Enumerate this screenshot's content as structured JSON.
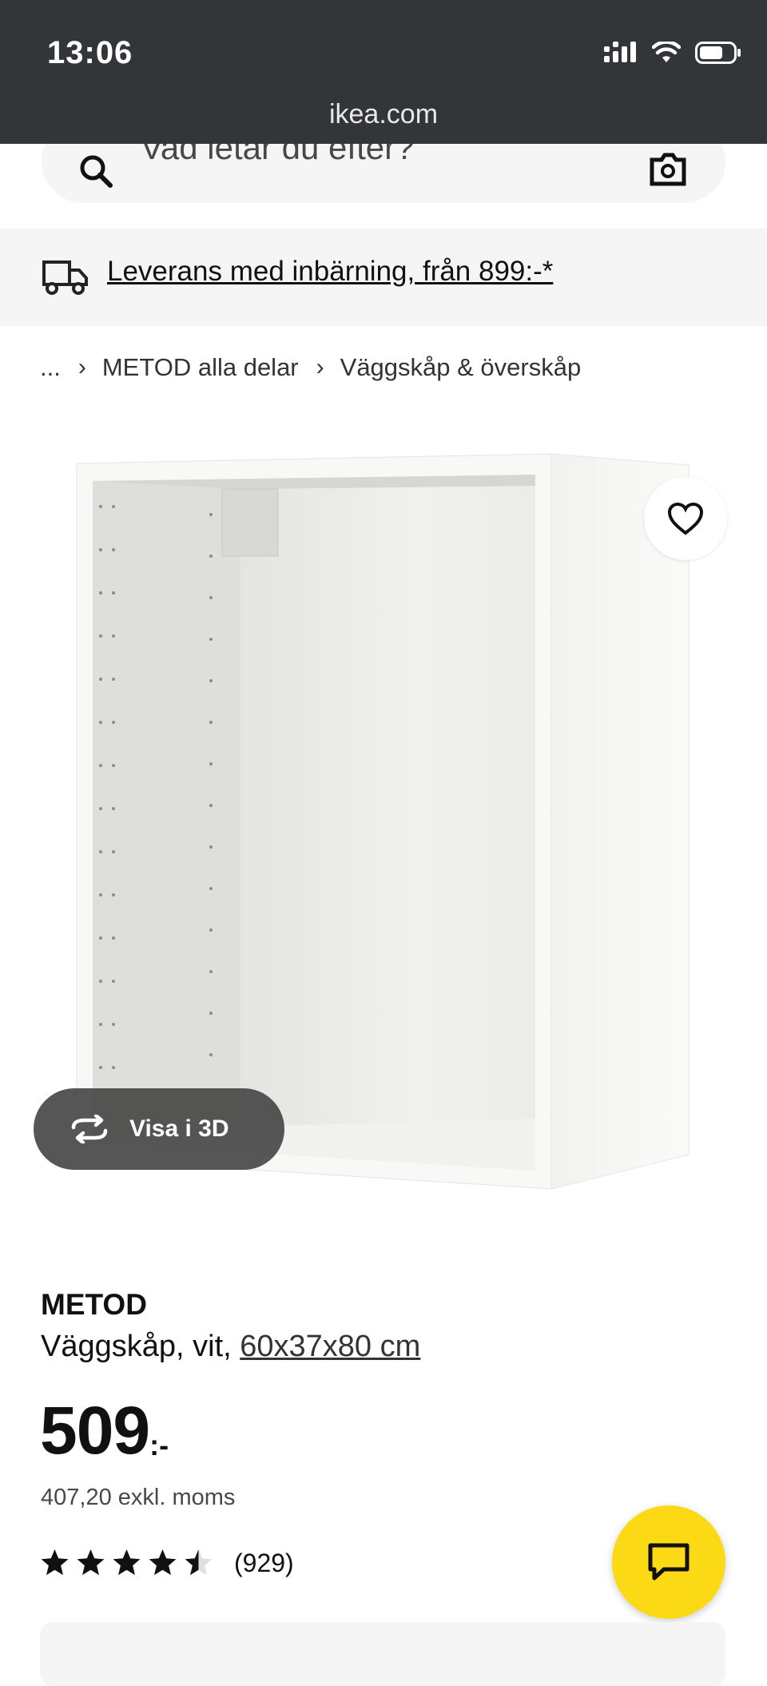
{
  "status_bar": {
    "time": "13:06",
    "url": "ikea.com"
  },
  "search": {
    "placeholder": "Vad letar du efter?"
  },
  "delivery": {
    "text": "Leverans med inbärning, från 899:-*"
  },
  "breadcrumb": {
    "ellipsis": "...",
    "items": [
      "METOD alla delar",
      "Väggskåp & överskåp"
    ]
  },
  "product": {
    "name": "METOD",
    "description": "Väggskåp, vit, ",
    "size": "60x37x80 cm",
    "price": "509",
    "price_suffix": ":-",
    "price_exkl": "407,20 exkl. moms",
    "rating": 4.5,
    "rating_max": 5,
    "review_count": "(929)"
  },
  "view3d": {
    "label": "Visa i 3D"
  },
  "colors": {
    "accent_yellow": "#fbd914",
    "status_bar": "#333638",
    "banner_bg": "#f5f5f5"
  },
  "icons": [
    "search-icon",
    "camera-icon",
    "truck-icon",
    "heart-icon",
    "rotate-3d-icon",
    "chat-icon",
    "star-icon"
  ]
}
